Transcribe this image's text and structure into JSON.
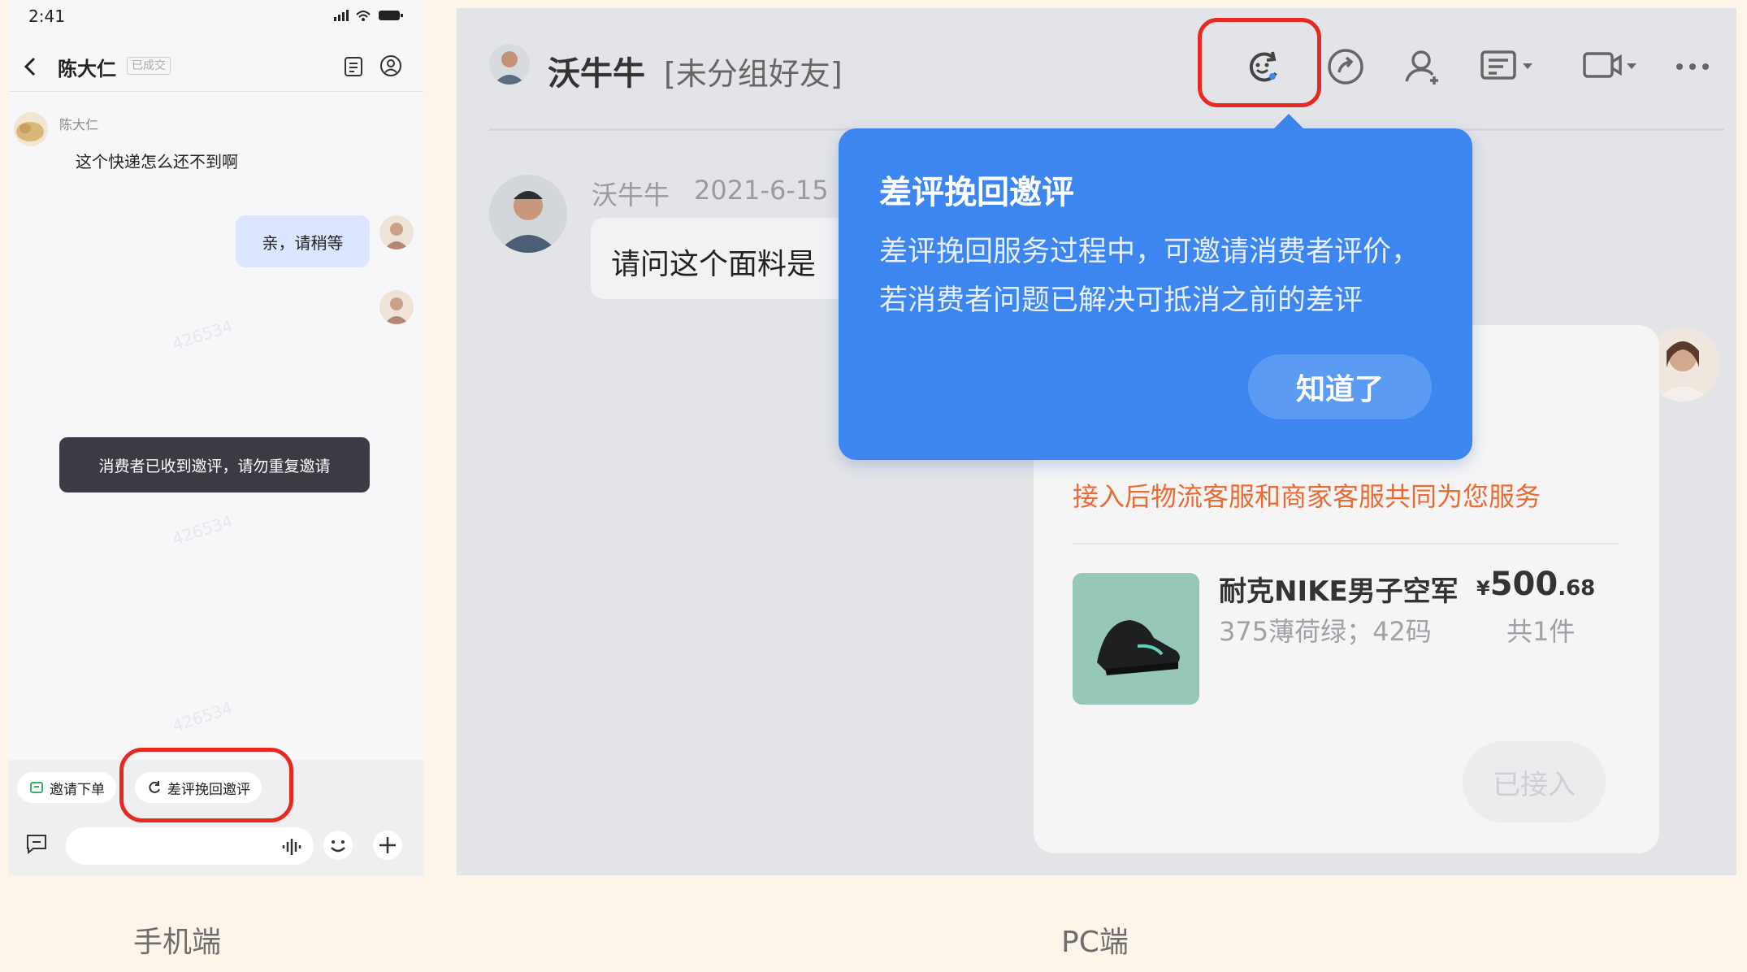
{
  "captions": {
    "phone": "手机端",
    "pc": "PC端"
  },
  "phone": {
    "status_time": "2:41",
    "contact_name": "陈大仁",
    "deal_badge": "已成交",
    "sender_name": "陈大仁",
    "incoming_message": "这个快递怎么还不到啊",
    "outgoing_message": "亲，请稍等",
    "toast": "消费者已收到邀评，请勿重复邀请",
    "chips": [
      "邀请下单",
      "差评挽回邀评"
    ],
    "watermark": "426534",
    "colors": {
      "highlight": "#e62a22",
      "bubble": "#dce5ff",
      "toast": "#3b3b44"
    }
  },
  "pc": {
    "contact_name": "沃牛牛",
    "group_label": "[未分组好友]",
    "toolbar_icons": [
      "review-recovery-icon",
      "share-icon",
      "add-contact-icon",
      "quick-reply-icon",
      "video-icon",
      "more-icon"
    ],
    "message": {
      "sender": "沃牛牛",
      "time": "2021-6-15",
      "text": "请问这个面料是"
    },
    "popover": {
      "title": "差评挽回邀评",
      "body": "差评挽回服务过程中，可邀请消费者评价，若消费者问题已解决可抵消之前的差评",
      "button": "知道了"
    },
    "card": {
      "service_note": "接入后物流客服和商家客服共同为您服务",
      "product_name": "耐克NIKE男子空军",
      "product_spec": "375薄荷绿；42码",
      "price_currency": "¥",
      "price_int": "500",
      "price_dec": ".68",
      "quantity": "共1件",
      "button": "已接入"
    },
    "colors": {
      "popover": "#3d86ef",
      "highlight": "#e62a22",
      "orange_text": "#ee6a33"
    }
  }
}
